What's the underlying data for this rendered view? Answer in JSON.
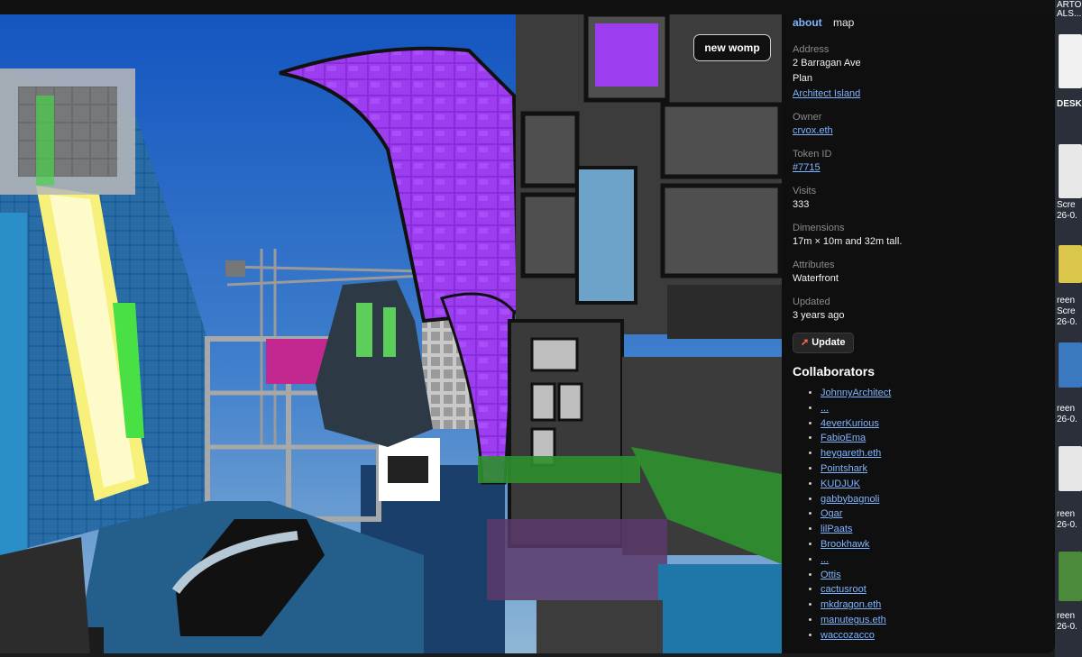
{
  "scene": {
    "new_womp_label": "new womp"
  },
  "tabs": [
    {
      "label": "about",
      "active": true
    },
    {
      "label": "map",
      "active": false
    }
  ],
  "details": {
    "address_label": "Address",
    "address_line": "2 Barragan Ave",
    "plan_line": "Plan",
    "island": "Architect Island",
    "owner_label": "Owner",
    "owner": "crvox.eth",
    "token_label": "Token ID",
    "token": "#7715",
    "visits_label": "Visits",
    "visits": "333",
    "dimensions_label": "Dimensions",
    "dimensions": "17m × 10m and 32m tall.",
    "attributes_label": "Attributes",
    "attributes": "Waterfront",
    "updated_label": "Updated",
    "updated": "3 years ago"
  },
  "update_button": {
    "label": "Update",
    "icon": "rocket-icon"
  },
  "collaborators": {
    "title": "Collaborators",
    "items": [
      "JohnnyArchitect",
      "...",
      "4everKurious",
      "FabioEma",
      "heygareth.eth",
      "Pointshark",
      "KUDJUK",
      "gabbybagnoli",
      "Ogar",
      "lilPaats",
      "Brookhawk",
      "...",
      "Ottis",
      "cactusroot",
      "mkdragon.eth",
      "manutegus.eth",
      "waccozacco"
    ]
  },
  "desktop_strip": {
    "labels": [
      "ARTO",
      "ALS...",
      "DESK",
      "Scre",
      "26-0.",
      "reen",
      "Scre",
      "26-0.",
      "reen",
      "26-0.",
      "reen",
      "26-0.",
      "reen",
      "26-0."
    ]
  },
  "colors": {
    "accent_link": "#7fb4ff",
    "sidebar_bg": "#0f0f0f",
    "purple_structure": "#8b2cdc"
  }
}
